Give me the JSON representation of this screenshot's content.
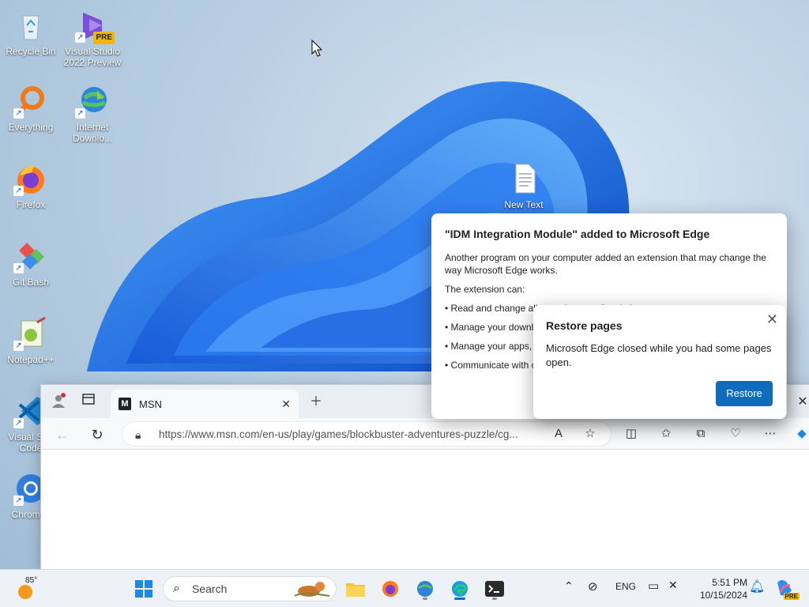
{
  "desktop": {
    "icons": [
      {
        "label": "Recycle Bin"
      },
      {
        "label": "Visual Studio 2022 Preview",
        "badge": "PRE"
      },
      {
        "label": "Everything"
      },
      {
        "label": "Internet Downlo..."
      },
      {
        "label": "Firefox"
      },
      {
        "label": "Git Bash"
      },
      {
        "label": "Notepad++"
      },
      {
        "label": "Visual St... Code"
      },
      {
        "label": "Chromi..."
      },
      {
        "label": "New Text"
      }
    ]
  },
  "browser": {
    "tab_title": "MSN",
    "tab_favicon_letter": "M",
    "url": "https://www.msn.com/en-us/play/games/blockbuster-adventures-puzzle/cg..."
  },
  "idm_popup": {
    "title": "\"IDM Integration Module\" added to Microsoft Edge",
    "description": "Another program on your computer added an extension that may change the way Microsoft Edge works.",
    "can_label": "The extension can:",
    "bullets": [
      "• Read and change all your data on all websites",
      "• Manage your downloads",
      "• Manage your apps, extensions, and themes",
      "• Communicate with cooperating native applications"
    ]
  },
  "restore_popup": {
    "title": "Restore pages",
    "message": "Microsoft Edge closed while you had some pages open.",
    "button": "Restore"
  },
  "taskbar": {
    "weather_temp": "85°",
    "search_placeholder": "Search",
    "language": "ENG",
    "time": "5:51 PM",
    "date": "10/15/2024",
    "copilot_badge": "PRE"
  },
  "colors": {
    "accent": "#0f6cbd",
    "wallpaper_blue": "#1e6fe6"
  }
}
